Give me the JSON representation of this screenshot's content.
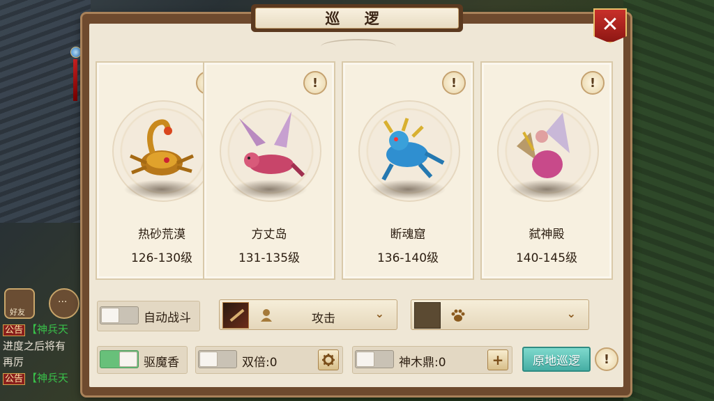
{
  "window": {
    "title": "巡 逻",
    "close_label": "✕"
  },
  "hud": {
    "friend_label": "好友",
    "chat_lines": [
      {
        "tag": "公告",
        "text": "【神兵天"
      },
      {
        "tag": "",
        "text": "进度之后将有"
      },
      {
        "tag": "",
        "text": "再厉"
      },
      {
        "tag": "公告",
        "text": "【神兵天"
      }
    ]
  },
  "cards": [
    {
      "name": "热砂荒漠",
      "level": "126-130级",
      "info": "!",
      "beast_icon": "scorpion-beast",
      "color": "#c98a1e"
    },
    {
      "name": "方丈岛",
      "level": "131-135级",
      "info": "!",
      "beast_icon": "winged-fox-beast",
      "color": "#c8456a"
    },
    {
      "name": "断魂窟",
      "level": "136-140级",
      "info": "!",
      "beast_icon": "lizard-beast",
      "color": "#2f8fd0"
    },
    {
      "name": "弑神殿",
      "level": "140-145级",
      "info": "!",
      "beast_icon": "winged-demon-beast",
      "color": "#c84a8a"
    }
  ],
  "controls": {
    "auto_battle": {
      "label": "自动战斗",
      "state": "off"
    },
    "attack_dropdown": {
      "value": "攻击",
      "user_icon": "person-icon"
    },
    "pet_dropdown": {
      "value": "",
      "paw_icon": "paw-icon"
    },
    "repel_incense": {
      "label": "驱魔香",
      "state": "on"
    },
    "double": {
      "label": "双倍:0",
      "state": "off"
    },
    "shenmu": {
      "label": "神木鼎:0",
      "state": "off"
    },
    "settings_icon": "gear-icon",
    "add_label": "+",
    "patrol_button": "原地巡逻",
    "help_label": "!"
  }
}
